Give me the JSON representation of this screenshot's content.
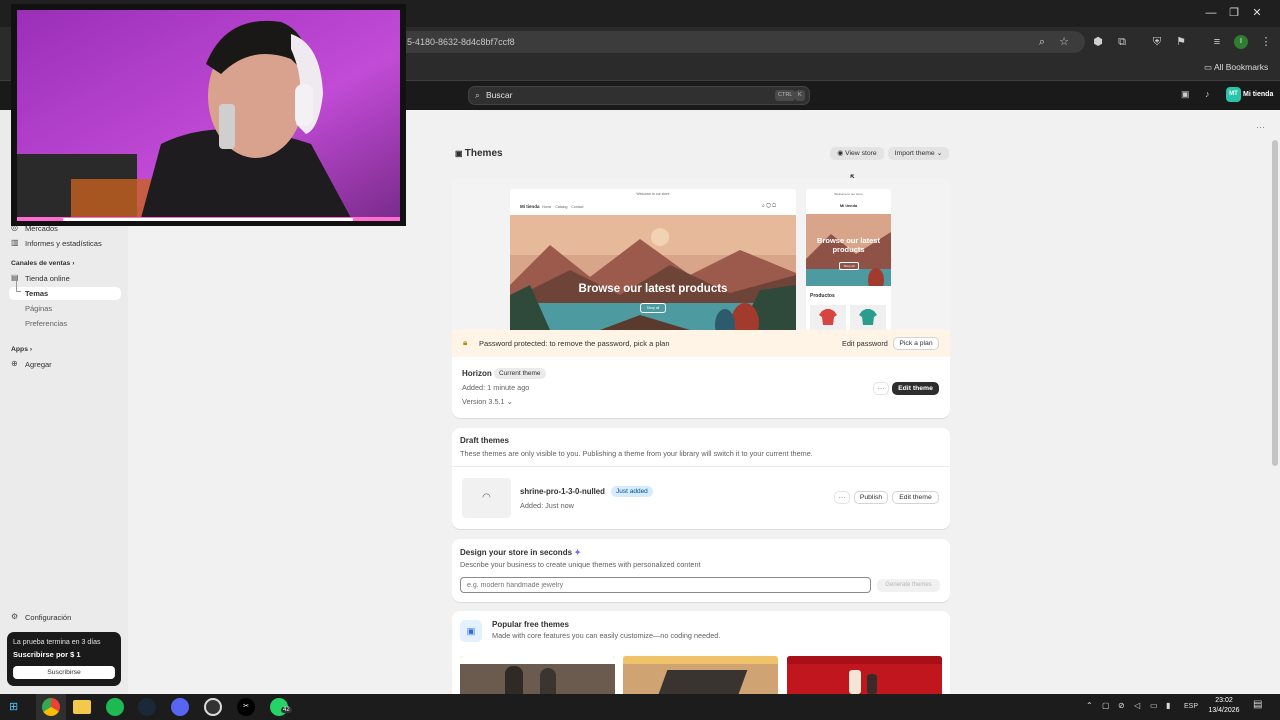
{
  "browser": {
    "url_fragment": "5-4180-8632-8d4c8bf7ccf8",
    "all_bookmarks": "All Bookmarks",
    "profile_letter": "I"
  },
  "topbar": {
    "search_placeholder": "Buscar",
    "kbd_ctrl": "CTRL",
    "kbd_k": "K",
    "store_initials": "MT",
    "store_name": "Mi tienda"
  },
  "sidebar": {
    "items_top": [
      {
        "label": "Mercados",
        "icon": "globe-icon"
      },
      {
        "label": "Informes y estadísticas",
        "icon": "chart-icon"
      }
    ],
    "sales_channels_heading": "Canales de ventas",
    "online_store": "Tienda online",
    "sub_items": [
      "Temas",
      "Páginas",
      "Preferencias"
    ],
    "apps_heading": "Apps",
    "add": "Agregar",
    "settings": "Configuración",
    "trial": {
      "line1": "La prueba termina en 3 días",
      "line2": "Suscribirse por $ 1",
      "button": "Suscribirse"
    }
  },
  "page": {
    "title": "Themes",
    "view_store": "View store",
    "import_theme": "Import theme"
  },
  "preview": {
    "desktop": {
      "announcement": "Welcome to our store",
      "logo": "Mi tienda",
      "nav": [
        "Home",
        "Catalog",
        "Contact"
      ],
      "hero": "Browse our latest products",
      "cta": "Shop all"
    },
    "mobile": {
      "announcement": "Welcome to our store",
      "logo": "Mi tienda",
      "hero": "Browse our latest products",
      "cta": "Shop all",
      "section": "Productos"
    }
  },
  "password_banner": {
    "text": "Password protected: to remove the password, pick a plan",
    "edit_password": "Edit password",
    "pick_plan": "Pick a plan"
  },
  "current_theme": {
    "name": "Horizon",
    "badge": "Current theme",
    "added": "Added: 1 minute ago",
    "version": "Version 3.5.1",
    "edit": "Edit theme",
    "more": "···"
  },
  "drafts": {
    "title": "Draft themes",
    "description": "These themes are only visible to you. Publishing a theme from your library will switch it to your current theme.",
    "item": {
      "name": "shrine-pro-1-3-0-nulled",
      "badge": "Just added",
      "added": "Added: Just now",
      "publish": "Publish",
      "edit": "Edit theme",
      "more": "···"
    }
  },
  "design": {
    "title": "Design your store in seconds",
    "subtitle": "Describe your business to create unique themes with personalized content",
    "placeholder": "e.g. modern handmade jewelry",
    "generate": "Generate themes"
  },
  "popular": {
    "title": "Popular free themes",
    "subtitle": "Made with core features you can easily customize—no coding needed."
  },
  "taskbar": {
    "lang": "ESP",
    "time": "23:02",
    "date": "13/4/2026",
    "whatsapp_badge": "42"
  },
  "colors": {
    "accent_green": "#29c4a9",
    "banner_bg": "#fff4e6",
    "badge_blue": "#d6ebff",
    "cam_magenta": "#b43fd0"
  }
}
